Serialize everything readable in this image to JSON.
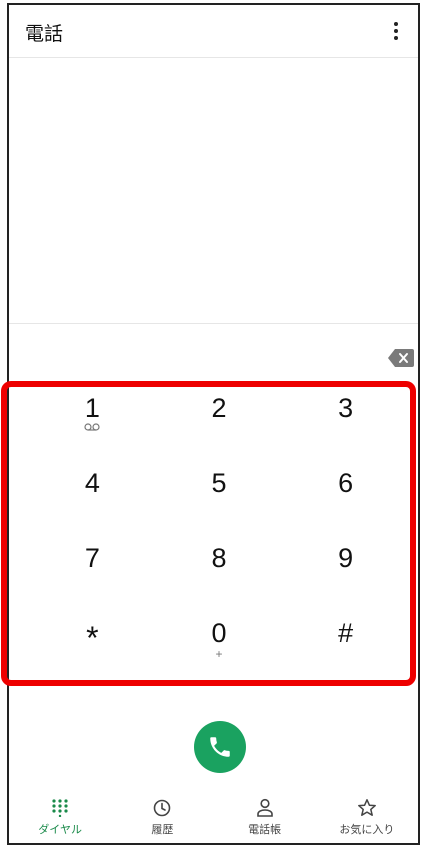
{
  "app": {
    "title": "電話"
  },
  "dialpad": {
    "keys": [
      {
        "digit": "1",
        "sub": ""
      },
      {
        "digit": "2",
        "sub": ""
      },
      {
        "digit": "3",
        "sub": ""
      },
      {
        "digit": "4",
        "sub": ""
      },
      {
        "digit": "5",
        "sub": ""
      },
      {
        "digit": "6",
        "sub": ""
      },
      {
        "digit": "7",
        "sub": ""
      },
      {
        "digit": "8",
        "sub": ""
      },
      {
        "digit": "9",
        "sub": ""
      },
      {
        "digit": "*",
        "sub": ""
      },
      {
        "digit": "0",
        "sub": "+"
      },
      {
        "digit": "#",
        "sub": ""
      }
    ]
  },
  "nav": {
    "items": [
      {
        "label": "ダイヤル",
        "icon": "dialpad-icon",
        "active": true
      },
      {
        "label": "履歴",
        "icon": "clock-icon",
        "active": false
      },
      {
        "label": "電話帳",
        "icon": "person-icon",
        "active": false
      },
      {
        "label": "お気に入り",
        "icon": "star-icon",
        "active": false
      }
    ]
  },
  "colors": {
    "accent": "#1aa260",
    "highlight": "#ee0000",
    "nav_active": "#1a8a4a"
  }
}
